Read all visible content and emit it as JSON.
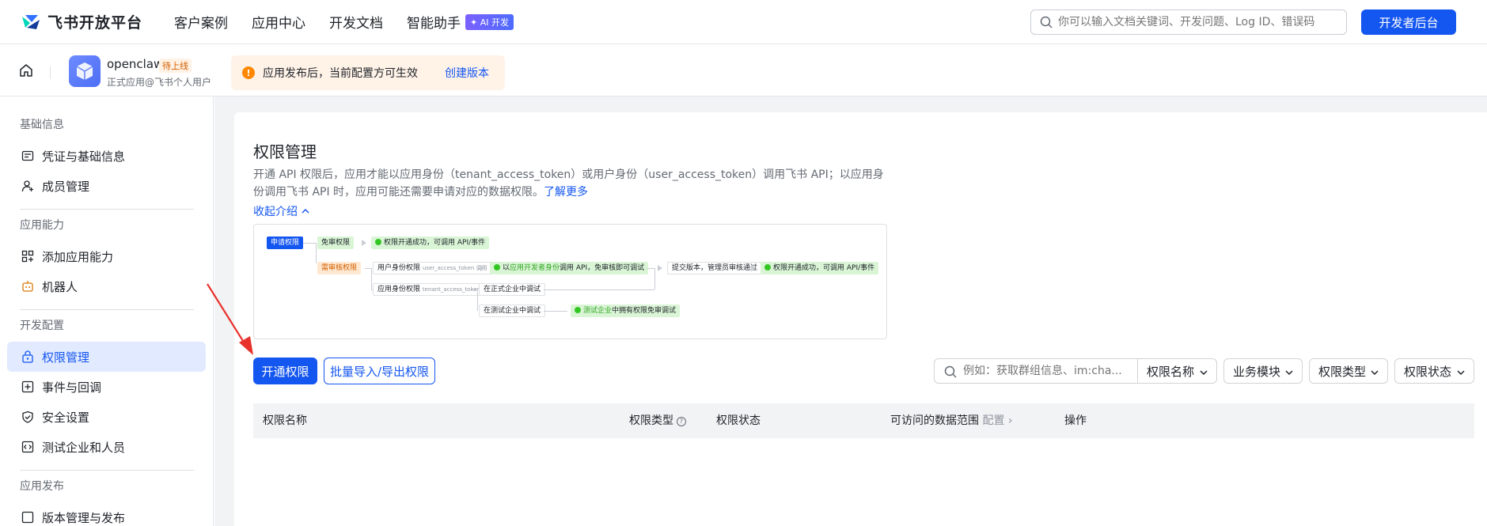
{
  "brand": {
    "name": "飞书开放平台"
  },
  "nav": {
    "links": [
      "客户案例",
      "应用中心",
      "开发文档",
      "智能助手"
    ],
    "ai_badge": "✦ AI 开发",
    "search_placeholder": "你可以输入文档关键词、开发问题、Log ID、错误码",
    "dev_button": "开发者后台"
  },
  "app": {
    "name": "openclaw",
    "status": "待上线",
    "subtitle": "正式应用@飞书个人用户"
  },
  "notice": {
    "text": "应用发布后，当前配置方可生效",
    "link": "创建版本"
  },
  "sidebar": {
    "groups": [
      {
        "title": "基础信息",
        "items": [
          {
            "label": "凭证与基础信息",
            "icon": "credential-icon"
          },
          {
            "label": "成员管理",
            "icon": "member-icon"
          }
        ]
      },
      {
        "title": "应用能力",
        "items": [
          {
            "label": "添加应用能力",
            "icon": "add-capability-icon"
          },
          {
            "label": "机器人",
            "icon": "robot-icon"
          }
        ]
      },
      {
        "title": "开发配置",
        "items": [
          {
            "label": "权限管理",
            "icon": "permission-icon",
            "active": true
          },
          {
            "label": "事件与回调",
            "icon": "event-icon"
          },
          {
            "label": "安全设置",
            "icon": "shield-icon"
          },
          {
            "label": "测试企业和人员",
            "icon": "code-icon"
          }
        ]
      },
      {
        "title": "应用发布",
        "items": [
          {
            "label": "版本管理与发布",
            "icon": "version-icon"
          }
        ]
      }
    ]
  },
  "main": {
    "title": "权限管理",
    "description": "开通 API 权限后，应用才能以应用身份（tenant_access_token）或用户身份（user_access_token）调用飞书 API；以应用身份调用飞书 API 时，应用可能还需要申请对应的数据权限。",
    "learn_more": "了解更多",
    "collapse": "收起介绍"
  },
  "flow": {
    "apply": "申请权限",
    "free": "免审权限",
    "free_result": "权限开通成功，可调用 API/事件",
    "review": "需审核权限",
    "user_perm": "用户身份权限",
    "user_token": "user_access_token 调用",
    "user_dev": "以",
    "user_dev_hl": "应用开发者身份",
    "user_dev_tail": "调用 API，免审核即可调试",
    "submit": "提交版本，管理员审核通过",
    "final_result": "权限开通成功，可调用 API/事件",
    "app_perm": "应用身份权限",
    "app_token": "tenant_access_token 调用",
    "prod_debug": "在正式企业中调试",
    "test_debug": "在测试企业中调试",
    "test_result_hl": "测试企业",
    "test_result_tail": "中拥有权限免审调试"
  },
  "actions": {
    "open_permission": "开通权限",
    "batch_import": "批量导入/导出权限"
  },
  "filters": {
    "search_placeholder": "例如：获取群组信息、im:cha...",
    "name": "权限名称",
    "module": "业务模块",
    "type": "权限类型",
    "status": "权限状态"
  },
  "table": {
    "headers": [
      "权限名称",
      "权限类型",
      "权限状态",
      "可访问的数据范围",
      "操作"
    ],
    "config_link": "配置"
  },
  "colors": {
    "brand_blue": "#1456f0",
    "active_bg": "#e1eaff",
    "annotation_red": "#e8312a"
  }
}
